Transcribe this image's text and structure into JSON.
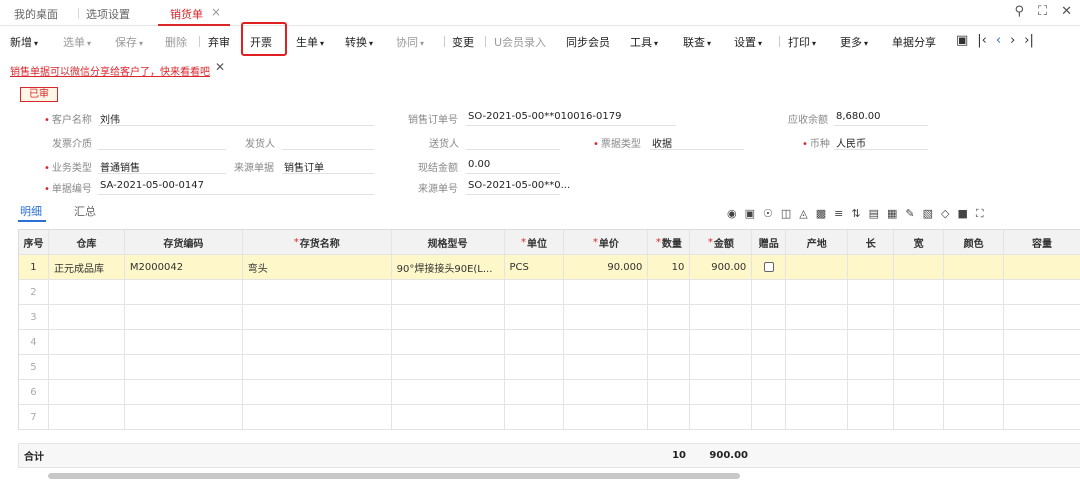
{
  "tabs": [
    {
      "label": "我的桌面"
    },
    {
      "label": "选项设置"
    },
    {
      "label": "销货单"
    }
  ],
  "toolbar": {
    "items": [
      {
        "label": "新增",
        "caret": true,
        "disabled": false
      },
      {
        "label": "选单",
        "caret": true,
        "disabled": true
      },
      {
        "label": "保存",
        "caret": true,
        "disabled": true
      },
      {
        "label": "删除",
        "caret": false,
        "disabled": true
      },
      {
        "label": "弃审",
        "caret": false,
        "disabled": false
      },
      {
        "label": "开票",
        "caret": false,
        "disabled": false
      },
      {
        "label": "生单",
        "caret": true,
        "disabled": false
      },
      {
        "label": "转换",
        "caret": true,
        "disabled": false
      },
      {
        "label": "协同",
        "caret": true,
        "disabled": true
      },
      {
        "label": "变更",
        "caret": false,
        "disabled": false
      },
      {
        "label": "U会员录入",
        "caret": false,
        "disabled": true
      },
      {
        "label": "同步会员",
        "caret": false,
        "disabled": false
      },
      {
        "label": "工具",
        "caret": true,
        "disabled": false
      },
      {
        "label": "联查",
        "caret": true,
        "disabled": false
      },
      {
        "label": "设置",
        "caret": true,
        "disabled": false
      },
      {
        "label": "打印",
        "caret": true,
        "disabled": false
      },
      {
        "label": "更多",
        "caret": true,
        "disabled": false
      },
      {
        "label": "单据分享",
        "caret": false,
        "disabled": false
      }
    ]
  },
  "notice": "销售单据可以微信分享给客户了，快来看看吧",
  "status_stamp": "已审",
  "form": {
    "customer_label": "客户名称",
    "customer_value": "刘伟",
    "sales_order_label": "销售订单号",
    "sales_order_value": "SO-2021-05-00**010016-0179",
    "receivable_label": "应收余额",
    "receivable_value": "8,680.00",
    "invoice_medium_label": "发票介质",
    "shipper_label": "发货人",
    "deliverer_label": "送货人",
    "bill_type_label": "票据类型",
    "bill_type_value": "收据",
    "currency_label": "币种",
    "currency_value": "人民币",
    "biz_type_label": "业务类型",
    "biz_type_value": "普通销售",
    "source_doc_label": "来源单据",
    "source_doc_value": "销售订单",
    "cash_label": "现结金额",
    "cash_value": "0.00",
    "doc_no_label": "单据编号",
    "doc_no_value": "SA-2021-05-00-0147",
    "source_no_label": "来源单号",
    "source_no_value": "SO-2021-05-00**0..."
  },
  "subtabs": [
    "明细",
    "汇总"
  ],
  "table": {
    "columns": [
      {
        "label": "序号",
        "req": false
      },
      {
        "label": "仓库",
        "req": false
      },
      {
        "label": "存货编码",
        "req": false
      },
      {
        "label": "存货名称",
        "req": true
      },
      {
        "label": "规格型号",
        "req": false
      },
      {
        "label": "单位",
        "req": true
      },
      {
        "label": "单价",
        "req": true
      },
      {
        "label": "数量",
        "req": true
      },
      {
        "label": "金额",
        "req": true
      },
      {
        "label": "赠品",
        "req": false
      },
      {
        "label": "产地",
        "req": false
      },
      {
        "label": "长",
        "req": false
      },
      {
        "label": "宽",
        "req": false
      },
      {
        "label": "颜色",
        "req": false
      },
      {
        "label": "容量",
        "req": false
      }
    ],
    "rows": [
      {
        "no": "1",
        "warehouse": "正元成品库",
        "code": "M2000042",
        "name": "弯头",
        "spec": "90°焊接接头90E(L...",
        "unit": "PCS",
        "price": "90.000",
        "qty": "10",
        "amount": "900.00"
      },
      {
        "no": "2"
      },
      {
        "no": "3"
      },
      {
        "no": "4"
      },
      {
        "no": "5"
      },
      {
        "no": "6"
      },
      {
        "no": "7"
      }
    ],
    "total_label": "合计",
    "total_qty": "10",
    "total_amount": "900.00"
  },
  "colors": {
    "accent_red": "#d9262c",
    "accent_blue": "#2a6fd6",
    "selected_row": "#fdf7c9"
  }
}
